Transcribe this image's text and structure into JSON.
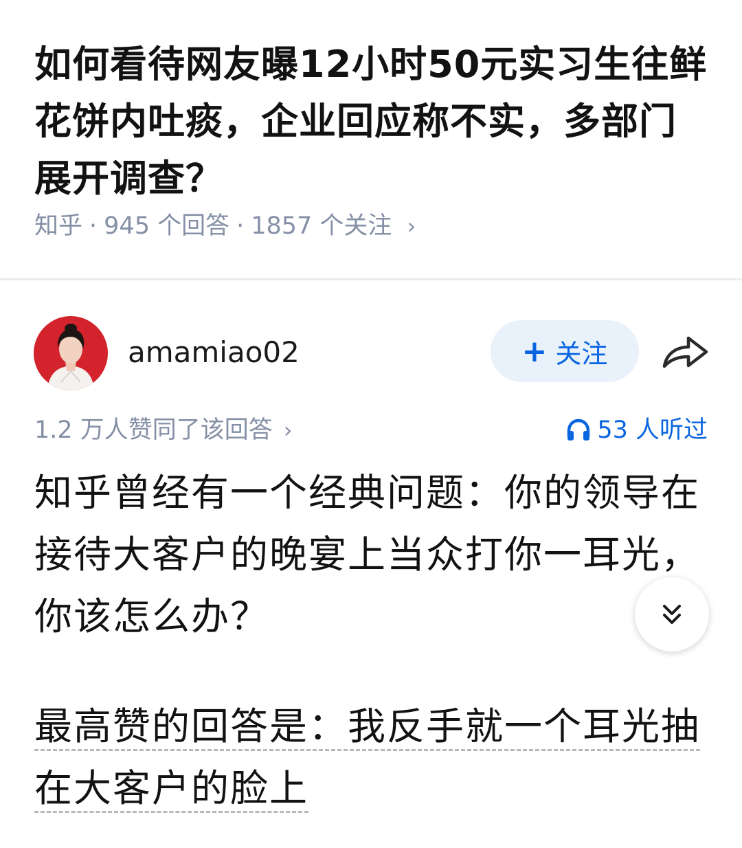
{
  "question": {
    "title": "如何看待网友曝12小时50元实习生往鲜花饼内吐痰，企业回应称不实，多部门展开调查？",
    "source": "知乎",
    "answers": "945 个回答",
    "followers": "1857 个关注"
  },
  "author": {
    "name": "amamiao02",
    "follow_label": "关注"
  },
  "stats": {
    "upvotes": "1.2 万人赞同了该回答",
    "listens": "53 人听过"
  },
  "answer": {
    "paragraph1": "知乎曾经有一个经典问题：你的领导在接待大客户的晚宴上当众打你一耳光，你该怎么办？",
    "paragraph2": "最高赞的回答是：我反手就一个耳光抽在大客户的脸上"
  },
  "icons": {
    "share": "share-arrow-icon",
    "headphone": "headphone-icon",
    "expand": "double-chevron-down-icon"
  },
  "colors": {
    "accent": "#0a66e0",
    "follow_bg": "#e9f1fb",
    "meta_gray": "#8590a6"
  }
}
